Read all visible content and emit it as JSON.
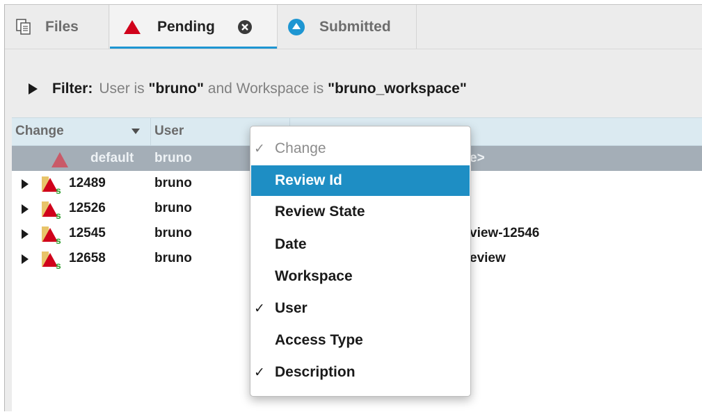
{
  "tabs": {
    "files": {
      "label": "Files",
      "icon": "document-icon"
    },
    "pending": {
      "label": "Pending",
      "icon": "triangle-icon",
      "close_icon": "close-icon"
    },
    "submitted": {
      "label": "Submitted",
      "icon": "up-arrow-circle-icon"
    }
  },
  "filter": {
    "key": "Filter:",
    "part1": "User is ",
    "user": "\"bruno\"",
    "part2": " and Workspace is ",
    "workspace": "\"bruno_workspace\""
  },
  "table": {
    "columns": {
      "change": "Change",
      "user": "User"
    },
    "rows": [
      {
        "change": "default",
        "user": "bruno",
        "description": "e>",
        "selected": true
      },
      {
        "change": "12489",
        "user": "bruno",
        "description": ""
      },
      {
        "change": "12526",
        "user": "bruno",
        "description": ""
      },
      {
        "change": "12545",
        "user": "bruno",
        "description": "view-12546"
      },
      {
        "change": "12658",
        "user": "bruno",
        "description": "eview"
      }
    ]
  },
  "menu": {
    "items": [
      {
        "label": "Change",
        "checked": true,
        "disabled": true
      },
      {
        "label": "Review Id",
        "checked": false,
        "highlighted": true
      },
      {
        "label": "Review State",
        "checked": false
      },
      {
        "label": "Date",
        "checked": false
      },
      {
        "label": "Workspace",
        "checked": false
      },
      {
        "label": "User",
        "checked": true
      },
      {
        "label": "Access Type",
        "checked": false
      },
      {
        "label": "Description",
        "checked": true
      }
    ],
    "check_glyph": "✓"
  },
  "colors": {
    "accent": "#1e96d2",
    "highlight": "#1e8ec4",
    "header_bg": "#dbeaf1",
    "selected_row": "#a4aeb7",
    "pending_red": "#d0021b"
  }
}
